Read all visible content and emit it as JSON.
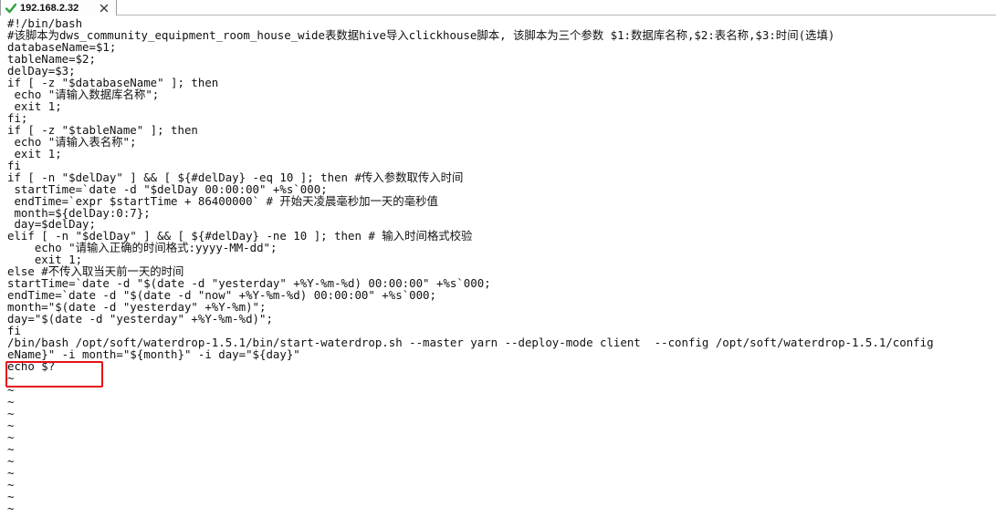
{
  "tab": {
    "title": "192.168.2.32",
    "status_icon": "check-icon",
    "close_icon": "close-icon",
    "status_color": "#2ba33c"
  },
  "terminal": {
    "lines": [
      "#!/bin/bash",
      "#该脚本为dws_community_equipment_room_house_wide表数据hive导入clickhouse脚本, 该脚本为三个参数 $1:数据库名称,$2:表名称,$3:时间(选填)",
      "databaseName=$1;",
      "tableName=$2;",
      "delDay=$3;",
      "if [ -z \"$databaseName\" ]; then",
      " echo \"请输入数据库名称\";",
      " exit 1;",
      "fi;",
      "if [ -z \"$tableName\" ]; then",
      " echo \"请输入表名称\";",
      " exit 1;",
      "fi",
      "if [ -n \"$delDay\" ] && [ ${#delDay} -eq 10 ]; then #传入参数取传入时间",
      " startTime=`date -d \"$delDay 00:00:00\" +%s`000;",
      " endTime=`expr $startTime + 86400000` # 开始天凌晨毫秒加一天的毫秒值",
      " month=${delDay:0:7};",
      " day=$delDay;",
      "elif [ -n \"$delDay\" ] && [ ${#delDay} -ne 10 ]; then # 输入时间格式校验",
      "    echo \"请输入正确的时间格式:yyyy-MM-dd\";",
      "    exit 1;",
      "else #不传入取当天前一天的时间",
      "startTime=`date -d \"$(date -d \"yesterday\" +%Y-%m-%d) 00:00:00\" +%s`000;",
      "endTime=`date -d \"$(date -d \"now\" +%Y-%m-%d) 00:00:00\" +%s`000;",
      "month=\"$(date -d \"yesterday\" +%Y-%m)\";",
      "day=\"$(date -d \"yesterday\" +%Y-%m-%d)\";",
      "fi",
      "/bin/bash /opt/soft/waterdrop-1.5.1/bin/start-waterdrop.sh --master yarn --deploy-mode client  --config /opt/soft/waterdrop-1.5.1/config",
      "eName}\" -i month=\"${month}\" -i day=\"${day}\"",
      "echo $?",
      "~",
      "~",
      "~",
      "~",
      "~",
      "~",
      "~",
      "~",
      "~",
      "~",
      "~",
      "~"
    ],
    "highlight_color": "#e8101a"
  }
}
